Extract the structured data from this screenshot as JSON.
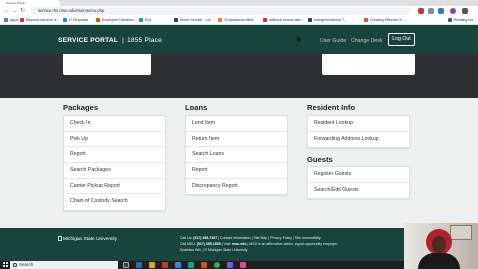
{
  "browser": {
    "tab_title": "Service Portal",
    "url": "service.rhs.msu.edu/mainmenu.php",
    "bookmarks": [
      {
        "label": "Apps",
        "color": "#4a7bd0"
      },
      {
        "label": "Beyond real-time a...",
        "color": "#c0392b"
      },
      {
        "label": "IT Requests",
        "color": "#2b7bd6"
      },
      {
        "label": "Employee Handboo...",
        "color": "#d35400"
      },
      {
        "label": "EQL",
        "color": "#16a085"
      },
      {
        "label": "World Service - Lot...",
        "color": "#2c3e50"
      },
      {
        "label": "10 Awesome Mind...",
        "color": "#e67e22"
      },
      {
        "label": "millenial versus bab...",
        "color": "#c0392b"
      },
      {
        "label": "Intergenerational T...",
        "color": "#2c3e50"
      },
      {
        "label": "Creating Effective S...",
        "color": "#e74c3c"
      },
      {
        "label": "Reading list",
        "color": "#555555"
      }
    ]
  },
  "header": {
    "brand": "SERVICE PORTAL",
    "separator": "|",
    "place": "1855 Place",
    "nav": [
      "User Guide",
      "Change Desk"
    ],
    "logout": "Log Out"
  },
  "columns": {
    "packages": {
      "title": "Packages",
      "items": [
        "Check In",
        "Pick Up",
        "Report",
        "Search Packages",
        "Carrier Pickup Report",
        "Chain of Custody Search"
      ]
    },
    "loans": {
      "title": "Loans",
      "items": [
        "Lend Item",
        "Return Item",
        "Search Loans",
        "Report",
        "Discrepancy Report"
      ]
    },
    "resident_info": {
      "title": "Resident Info",
      "items": [
        "Resident Lookup",
        "Forwarding Address Lookup"
      ]
    },
    "guests": {
      "title": "Guests",
      "items": [
        "Register Guests",
        "Search/Edit Guests"
      ]
    }
  },
  "footer": {
    "logo_alt": "Michigan State University",
    "line1_prefix": "Call Us:",
    "line1_phone": "(517) 355-7457",
    "line1_rest": "| Contact Information | Site Map | Privacy Policy | Site Accessibility",
    "line2_prefix": "Call MSU:",
    "line2_phone": "(517) 355-1855",
    "line2_mid": "| Visit:",
    "line2_site": "msu.edu",
    "line2_rest": "| MSU is an affirmative-action, equal-opportunity employer.",
    "line3_spartans": "Spartans Will.",
    "line3_rest": "| © Michigan State University"
  },
  "taskbar": {
    "search_placeholder": "Search"
  },
  "colors": {
    "msu_green": "#18453b",
    "hero_dark": "#2e3132"
  }
}
